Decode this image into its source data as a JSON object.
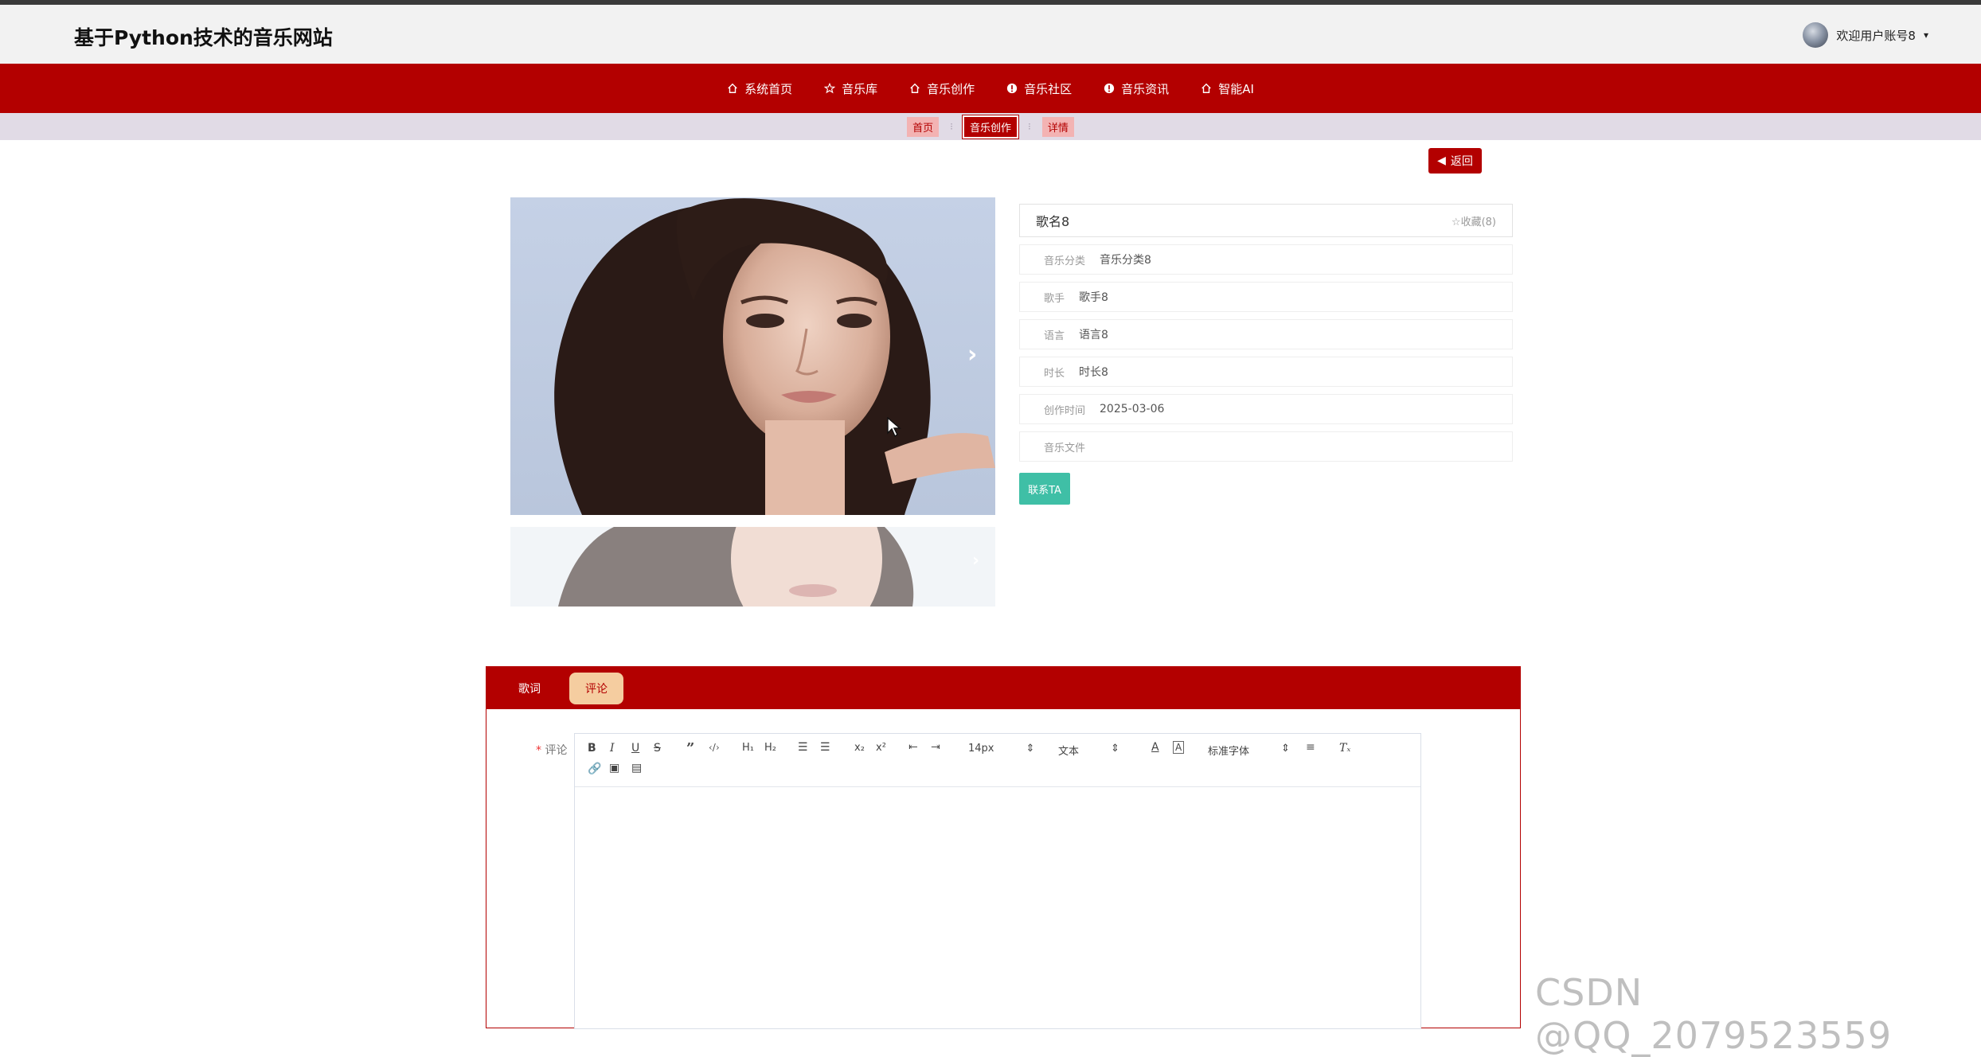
{
  "header": {
    "site_title": "基于Python技术的音乐网站",
    "user_welcome": "欢迎用户账号8",
    "user_caret": "▾"
  },
  "nav": {
    "items": [
      {
        "label": "系统首页",
        "icon": "home-icon"
      },
      {
        "label": "音乐库",
        "icon": "star-icon"
      },
      {
        "label": "音乐创作",
        "icon": "home-icon"
      },
      {
        "label": "音乐社区",
        "icon": "info-circle-icon"
      },
      {
        "label": "音乐资讯",
        "icon": "info-circle-icon"
      },
      {
        "label": "智能AI",
        "icon": "home-icon"
      }
    ]
  },
  "breadcrumb": {
    "home": "首页",
    "section": "音乐创作",
    "current": "详情",
    "separator": "⁝"
  },
  "back_button": {
    "label": "返回"
  },
  "detail": {
    "song_name": "歌名8",
    "favorite": "☆收藏(8)",
    "fields": [
      {
        "label": "音乐分类",
        "value": "音乐分类8"
      },
      {
        "label": "歌手",
        "value": "歌手8"
      },
      {
        "label": "语言",
        "value": "语言8"
      },
      {
        "label": "时长",
        "value": "时长8"
      },
      {
        "label": "创作时间",
        "value": "2025-03-06"
      },
      {
        "label": "音乐文件",
        "value": ""
      }
    ],
    "contact_button": "联系TA"
  },
  "tabs": {
    "items": [
      {
        "label": "歌词",
        "active": false
      },
      {
        "label": "评论",
        "active": true
      }
    ]
  },
  "comment_form": {
    "required_mark": "*",
    "label": "评论",
    "toolbar": {
      "font_size": "14px",
      "header_select": "文本",
      "font_family": "标准字体"
    }
  },
  "watermark": "CSDN @QQ_2079523559",
  "colors": {
    "brand_red": "#b30000",
    "contact_teal": "#3fbfa6",
    "active_tab_bg": "#f5cda0",
    "breadcrumb_bg": "#e1dbe6"
  }
}
